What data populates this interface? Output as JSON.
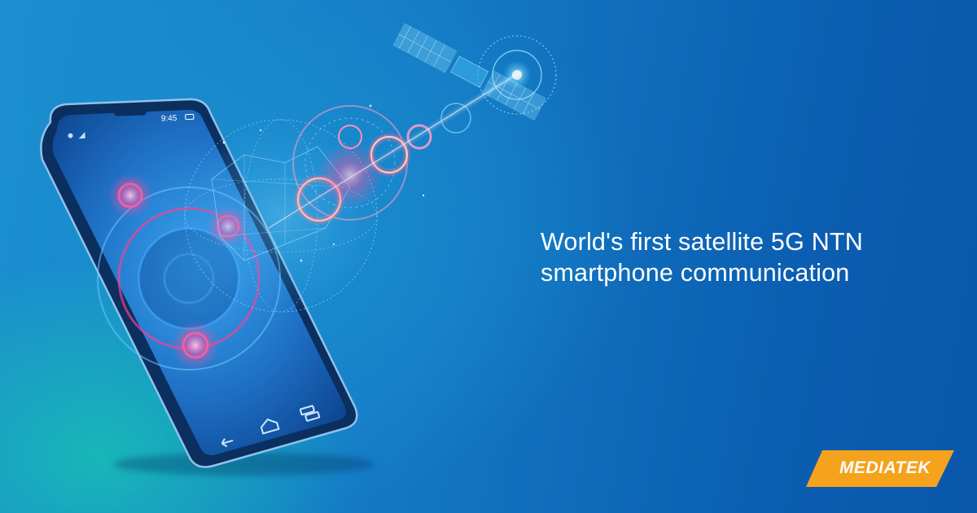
{
  "headline": {
    "line1": "World's first satellite 5G NTN",
    "line2": "smartphone communication"
  },
  "phone": {
    "status_time": "9:45",
    "nav_icons": [
      "back-icon",
      "home-icon",
      "recents-icon"
    ]
  },
  "brand": {
    "logo_text": "MEDIATEK",
    "accent_color": "#f5a21c"
  },
  "colors": {
    "background_primary": "#1378c4",
    "background_teal": "#18b6b8",
    "text": "#ffffff",
    "glow_pink": "#ff4fa0",
    "glow_cyan": "#7fe8ff"
  }
}
